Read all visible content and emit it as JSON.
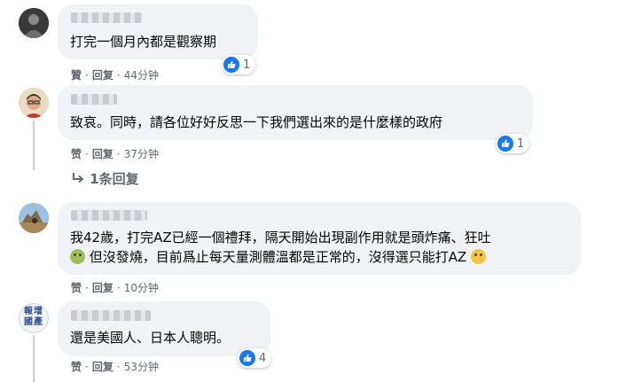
{
  "comments": [
    {
      "text": "打完一個月內都是觀察期",
      "reaction_count": "1",
      "actions": {
        "like": "贊",
        "reply": "回复",
        "time": "44分钟"
      }
    },
    {
      "text": "致哀。同時，請各位好好反思一下我們選出來的是什麼樣的政府",
      "reaction_count": "1",
      "actions": {
        "like": "赞",
        "reply": "回复",
        "time": "37分钟"
      },
      "replies_label": "1条回复"
    },
    {
      "line1": "我42歲，打完AZ已經一個禮拜，隔天開始出現副作用就是頭炸痛、狂吐",
      "line2_a": "但沒發燒，目前爲止每天量測體溫都是正常的，沒得選只能打AZ",
      "actions": {
        "like": "赞",
        "reply": "回复",
        "time": "10分钟"
      }
    },
    {
      "text": "還是美國人、日本人聰明。",
      "reaction_count": "4",
      "avatar_text": "報增國產",
      "actions": {
        "like": "赞",
        "reply": "回复",
        "time": "53分钟"
      }
    }
  ],
  "icons": {
    "reaction": "like-thumb-icon",
    "reply_arrow": "reply-arrow-icon",
    "emoji_sick": "nauseated-face-emoji",
    "emoji_tired": "tired-face-emoji"
  },
  "colors": {
    "bubble": "#f0f2f5",
    "like_blue": "#1877f2",
    "meta_gray": "#65676b"
  }
}
